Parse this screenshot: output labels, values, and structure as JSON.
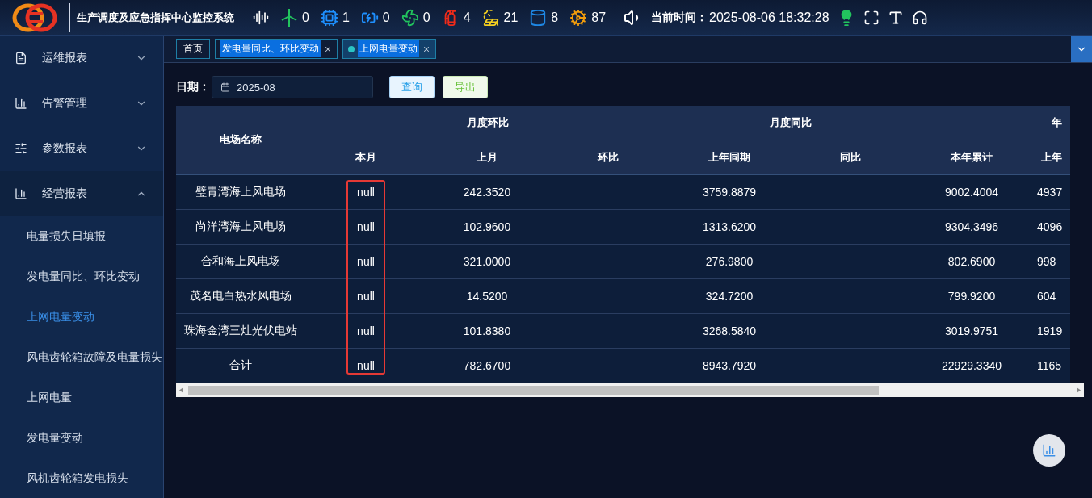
{
  "header": {
    "title": "生产调度及应急指挥中心监控系统",
    "stats": [
      {
        "kind": "turbine",
        "count": "0",
        "color": "#22c55e"
      },
      {
        "kind": "device",
        "count": "1",
        "color": "#1e90ff"
      },
      {
        "kind": "battery",
        "count": "0",
        "color": "#1e90ff"
      },
      {
        "kind": "fan",
        "count": "0",
        "color": "#22c55e"
      },
      {
        "kind": "extinguisher",
        "count": "4",
        "color": "#ef2b1a"
      },
      {
        "kind": "solar",
        "count": "21",
        "color": "#f5d020"
      },
      {
        "kind": "cable",
        "count": "8",
        "color": "#1e88e5"
      },
      {
        "kind": "gears",
        "count": "87",
        "color": "#f59e0b"
      }
    ],
    "time_label": "当前时间：",
    "time": "2025-08-06 18:32:28"
  },
  "sidebar": {
    "groups": [
      {
        "label": "运维报表",
        "expanded": false
      },
      {
        "label": "告警管理",
        "expanded": false
      },
      {
        "label": "参数报表",
        "expanded": false
      },
      {
        "label": "经营报表",
        "expanded": true,
        "children": [
          {
            "label": "电量损失日填报",
            "selected": false
          },
          {
            "label": "发电量同比、环比变动",
            "selected": false
          },
          {
            "label": "上网电量变动",
            "selected": true
          },
          {
            "label": "风电齿轮箱故障及电量损失",
            "selected": false
          },
          {
            "label": "上网电量",
            "selected": false
          },
          {
            "label": "发电量变动",
            "selected": false
          },
          {
            "label": "风机齿轮箱发电损失",
            "selected": false
          }
        ]
      }
    ]
  },
  "tabs": [
    {
      "label": "首页",
      "closable": false,
      "text_highlighted": false,
      "selected": false
    },
    {
      "label": "发电量同比、环比变动",
      "closable": true,
      "text_highlighted": true,
      "selected": false
    },
    {
      "label": "上网电量变动",
      "closable": true,
      "text_highlighted": true,
      "selected": true
    }
  ],
  "filter": {
    "label": "日期：",
    "value": "2025-08",
    "buttons": [
      {
        "label": "查询",
        "kind": "query"
      },
      {
        "label": "导出",
        "kind": "export"
      }
    ]
  },
  "table": {
    "first_column": "电场名称",
    "groups": [
      "月度环比",
      "月度同比",
      "年"
    ],
    "columns": [
      {
        "label": "本月",
        "highlighted": true
      },
      {
        "label": "上月",
        "highlighted": false
      },
      {
        "label": "环比",
        "highlighted": false
      },
      {
        "label": "上年同期",
        "highlighted": false
      },
      {
        "label": "同比",
        "highlighted": false
      },
      {
        "label": "本年累计",
        "highlighted": false
      },
      {
        "label": "上年",
        "highlighted": false
      }
    ],
    "rows": [
      {
        "name": "璧青湾海上风电场",
        "cells": [
          "null",
          "242.3520",
          "",
          "3759.8879",
          "",
          "9002.4004",
          "4937"
        ]
      },
      {
        "name": "尚洋湾海上风电场",
        "cells": [
          "null",
          "102.9600",
          "",
          "1313.6200",
          "",
          "9304.3496",
          "4096"
        ]
      },
      {
        "name": "合和海上风电场",
        "cells": [
          "null",
          "321.0000",
          "",
          "276.9800",
          "",
          "802.6900",
          "998"
        ]
      },
      {
        "name": "茂名电白热水风电场",
        "cells": [
          "null",
          "14.5200",
          "",
          "324.7200",
          "",
          "799.9200",
          "604"
        ]
      },
      {
        "name": "珠海金湾三灶光伏电站",
        "cells": [
          "null",
          "101.8380",
          "",
          "3268.5840",
          "",
          "3019.9751",
          "1919"
        ]
      },
      {
        "name": "合计",
        "cells": [
          "null",
          "782.6700",
          "",
          "8943.7920",
          "",
          "22929.3340",
          "1165"
        ]
      }
    ]
  }
}
